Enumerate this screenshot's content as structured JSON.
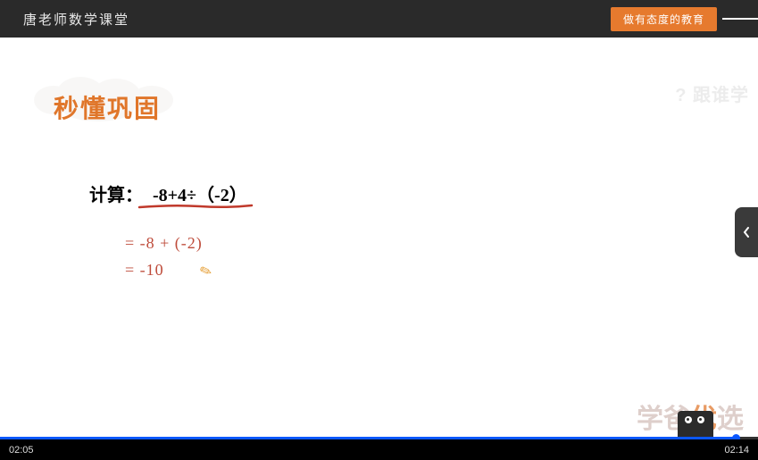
{
  "header": {
    "channel_title": "唐老师数学课堂",
    "edu_badge": "做有态度的教育"
  },
  "section": {
    "title": "秒懂巩固"
  },
  "problem": {
    "label": "计算：",
    "expression": "-8+4÷（-2）"
  },
  "work": {
    "line1": "= -8 + (-2)",
    "line2": "= -10"
  },
  "watermarks": {
    "top": "? 跟谁学",
    "bottom_a": "学爸",
    "bottom_b": "优",
    "bottom_c": "选"
  },
  "player": {
    "current_time": "02:05",
    "total_time": "02:14",
    "progress_percent": 97
  },
  "colors": {
    "accent_orange": "#e67a2e",
    "handwriting_red": "#be4b3a",
    "progress_blue": "#0b57ff"
  }
}
